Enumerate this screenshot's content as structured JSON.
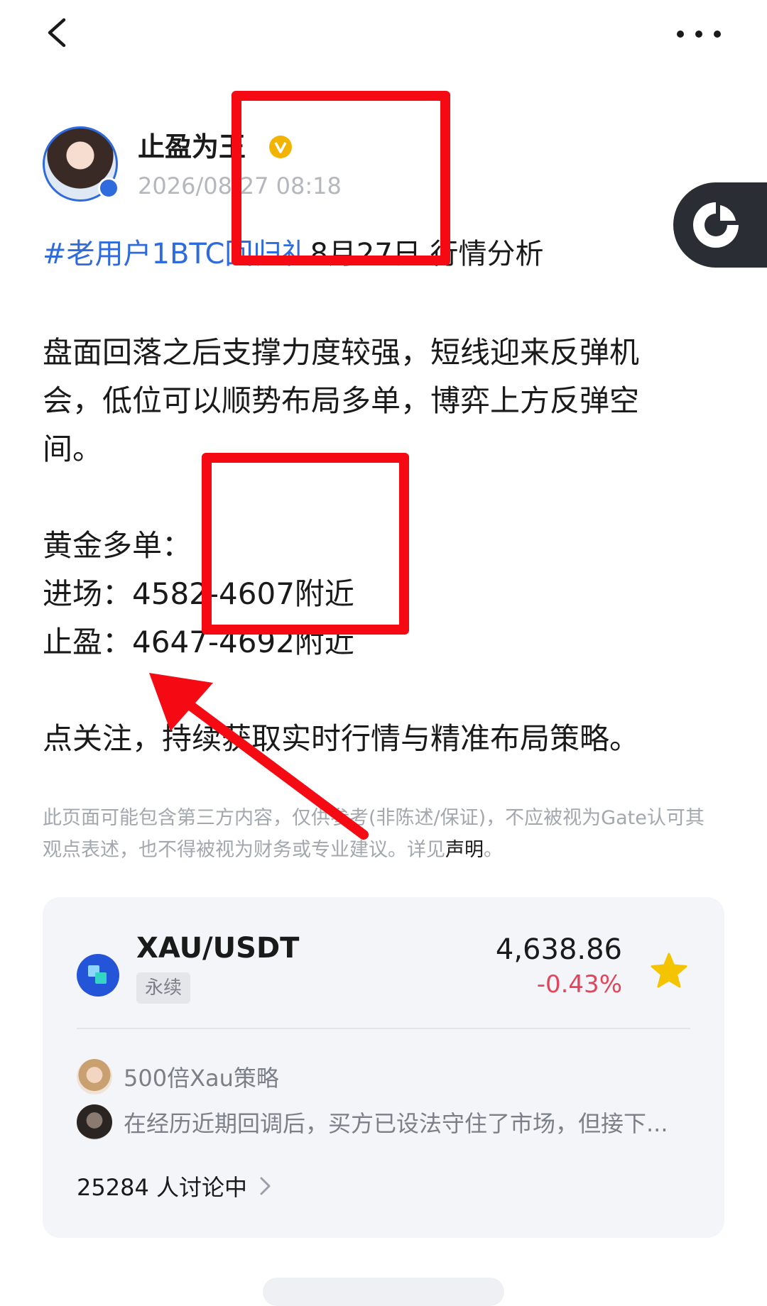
{
  "author": {
    "name": "止盈为王",
    "time": "2026/08/27 08:18"
  },
  "post": {
    "title_tag": "#老用户1BTC回归礼",
    "title_rest": "8月27日 行情分析",
    "p1": "盘面回落之后支撑力度较强，短线迎来反弹机会，低位可以顺势布局多单，博弈上方反弹空间。",
    "p2": "黄金多单：",
    "p3": "进场：4582-4607附近",
    "p4": "止盈：4647-4692附近",
    "p5": "点关注，持续获取实时行情与精准布局策略。"
  },
  "disclaimer": {
    "text": "此页面可能包含第三方内容，仅供参考(非陈述/保证)，不应被视为Gate认可其观点表述，也不得被视为财务或专业建议。详见",
    "link": "声明",
    "end": "。"
  },
  "market": {
    "pair": "XAU/USDT",
    "tag": "永续",
    "price": "4,638.86",
    "change": "-0.43%",
    "strategy": "500倍Xau策略",
    "comment": "在经历近期回调后，买方已设法守住了市场，但接下...",
    "discussion": "25284 人讨论中"
  },
  "colors": {
    "accent": "#2f6bdc",
    "negative": "#e2445c",
    "annotation": "#f50a14"
  }
}
